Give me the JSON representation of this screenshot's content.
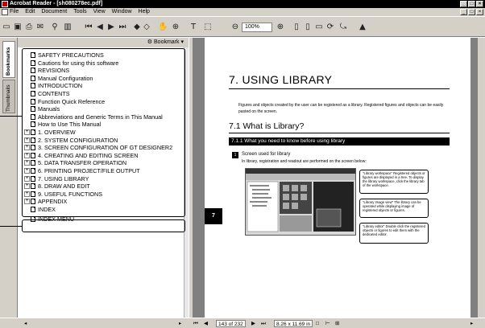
{
  "window": {
    "title": "Acrobat Reader - [sh080278ec.pdf]"
  },
  "menu": [
    "File",
    "Edit",
    "Document",
    "Tools",
    "View",
    "Window",
    "Help"
  ],
  "toolbar": {
    "zoom": "100%"
  },
  "tabs": {
    "bookmarks": "Bookmarks",
    "thumbnails": "Thumbnails"
  },
  "bookmarks_header": "Bookmark",
  "bookmarks": [
    {
      "label": "SAFETY PRECAUTIONS",
      "exp": ""
    },
    {
      "label": "Cautions for using this software",
      "exp": ""
    },
    {
      "label": "REVISIONS",
      "exp": ""
    },
    {
      "label": "Manual Configuration",
      "exp": ""
    },
    {
      "label": "INTRODUCTION",
      "exp": ""
    },
    {
      "label": "CONTENTS",
      "exp": ""
    },
    {
      "label": "Function Quick Reference",
      "exp": ""
    },
    {
      "label": "Manuals",
      "exp": ""
    },
    {
      "label": "Abbreviations and Generic Terms in This Manual",
      "exp": ""
    },
    {
      "label": "How to Use This Manual",
      "exp": ""
    },
    {
      "label": "1. OVERVIEW",
      "exp": "+"
    },
    {
      "label": "2. SYSTEM CONFIGURATION",
      "exp": "+"
    },
    {
      "label": "3. SCREEN CONFIGURATION OF GT DESIGNER2",
      "exp": "+"
    },
    {
      "label": "4. CREATING AND EDITING SCREEN",
      "exp": "+"
    },
    {
      "label": "5. DATA TRANSFER OPERATION",
      "exp": "+"
    },
    {
      "label": "6. PRINTING PROJECT/FILE OUTPUT",
      "exp": "+"
    },
    {
      "label": "7. USING LIBRARY",
      "exp": "+"
    },
    {
      "label": "8. DRAW AND EDIT",
      "exp": "+"
    },
    {
      "label": "9. USEFUL FUNCTIONS",
      "exp": "+"
    },
    {
      "label": "APPENDIX",
      "exp": "+"
    },
    {
      "label": "INDEX",
      "exp": ""
    },
    {
      "label": "INDEX MENU",
      "exp": ""
    }
  ],
  "page": {
    "chapter_tab": "7",
    "chapter_title": "7. USING LIBRARY",
    "intro": "Figures and objects created by the user can be registered as a library. Registered figures and objects can be easily pasted on the screen.",
    "section_title": "7.1 What is Library?",
    "subsection_title": "7.1.1 What you need to know before using library",
    "step_number": "1",
    "step_title": "Screen used for library",
    "step_text": "In library, registration and readout are performed on the screen below:",
    "callouts": [
      "\"Library workspace\" Registered objects or figures are displayed in a tree. To display the library workspace, click the library tab of the workspace.",
      "\"Library Image view\" The library can be operated while displaying image of registered objects or figures.",
      "\"Library editor\" Double click the registered objects or figures to edit them with the dedicated editor."
    ]
  },
  "status": {
    "page": "143 of 232",
    "size": "8.26 x 11.69 in"
  }
}
